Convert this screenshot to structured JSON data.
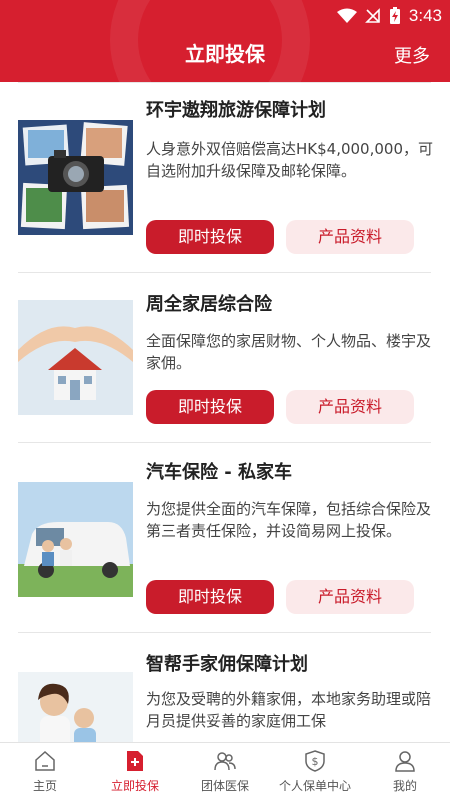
{
  "status_bar": {
    "time": "3:43"
  },
  "header": {
    "title": "立即投保",
    "more_label": "更多"
  },
  "products": [
    {
      "title": "环宇遨翔旅游保障计划",
      "description": "人身意外双倍赔偿高达HK$4,000,000，可自选附加升级保障及邮轮保障。",
      "primary_button": "即时投保",
      "secondary_button": "产品资料",
      "image": "travel-photos-camera"
    },
    {
      "title": "周全家居综合险",
      "description": "全面保障您的家居财物、个人物品、楼宇及家佣。",
      "primary_button": "即时投保",
      "secondary_button": "产品资料",
      "image": "hands-protecting-house"
    },
    {
      "title": "汽车保险 - 私家车",
      "description": "为您提供全面的汽车保障，包括综合保险及第三者责任保险，并设简易网上投保。",
      "primary_button": "即时投保",
      "secondary_button": "产品资料",
      "image": "family-with-car"
    },
    {
      "title": "智帮手家佣保障计划",
      "description": "为您及受聘的外籍家佣，本地家务助理或陪月员提供妥善的家庭佣工保",
      "image": "mother-and-child"
    }
  ],
  "bottom_nav": [
    {
      "label": "主页",
      "icon": "home-icon",
      "active": false
    },
    {
      "label": "立即投保",
      "icon": "add-document-icon",
      "active": true
    },
    {
      "label": "团体医保",
      "icon": "group-people-icon",
      "active": false
    },
    {
      "label": "个人保单中心",
      "icon": "dollar-shield-icon",
      "active": false
    },
    {
      "label": "我的",
      "icon": "user-icon",
      "active": false
    }
  ],
  "colors": {
    "brand_red": "#d61f2f",
    "button_red": "#c91c2b",
    "button_light": "#fbe9ea"
  }
}
